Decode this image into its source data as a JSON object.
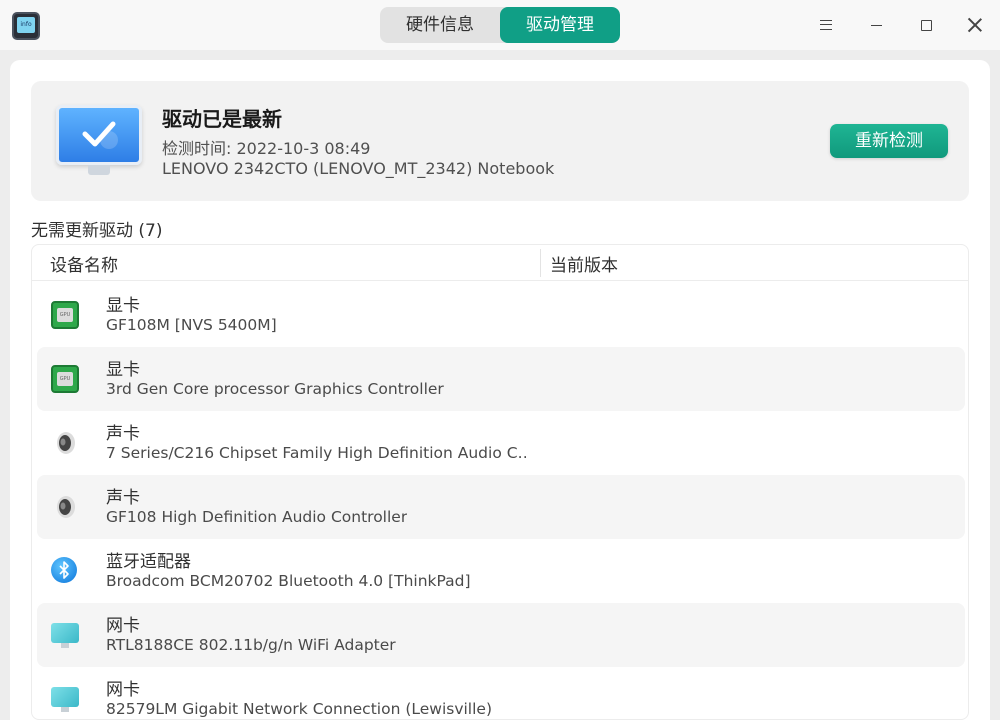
{
  "app": {
    "icon_text": "info",
    "tabs": [
      {
        "label": "硬件信息",
        "active": false
      },
      {
        "label": "驱动管理",
        "active": true
      }
    ]
  },
  "status": {
    "title": "驱动已是最新",
    "check_time": "检测时间: 2022-10-3 08:49",
    "model": "LENOVO 2342CTO (LENOVO_MT_2342) Notebook",
    "recheck_label": "重新检测"
  },
  "section": {
    "title": "无需更新驱动 (7)"
  },
  "table": {
    "headers": {
      "name": "设备名称",
      "version": "当前版本"
    },
    "rows": [
      {
        "category": "显卡",
        "device": "GF108M [NVS 5400M]",
        "icon": "gpu-icon"
      },
      {
        "category": "显卡",
        "device": "3rd Gen Core processor Graphics Controller",
        "icon": "gpu-icon"
      },
      {
        "category": "声卡",
        "device": "7 Series/C216 Chipset Family High Definition Audio C…",
        "icon": "speaker-icon"
      },
      {
        "category": "声卡",
        "device": "GF108 High Definition Audio Controller",
        "icon": "speaker-icon"
      },
      {
        "category": "蓝牙适配器",
        "device": "Broadcom BCM20702 Bluetooth 4.0 [ThinkPad]",
        "icon": "bluetooth-icon"
      },
      {
        "category": "网卡",
        "device": "RTL8188CE 802.11b/g/n WiFi Adapter",
        "icon": "network-icon"
      },
      {
        "category": "网卡",
        "device": "82579LM Gigabit Network Connection (Lewisville)",
        "icon": "network-icon"
      }
    ]
  },
  "colors": {
    "accent": "#109f86",
    "button": "#14a888"
  }
}
